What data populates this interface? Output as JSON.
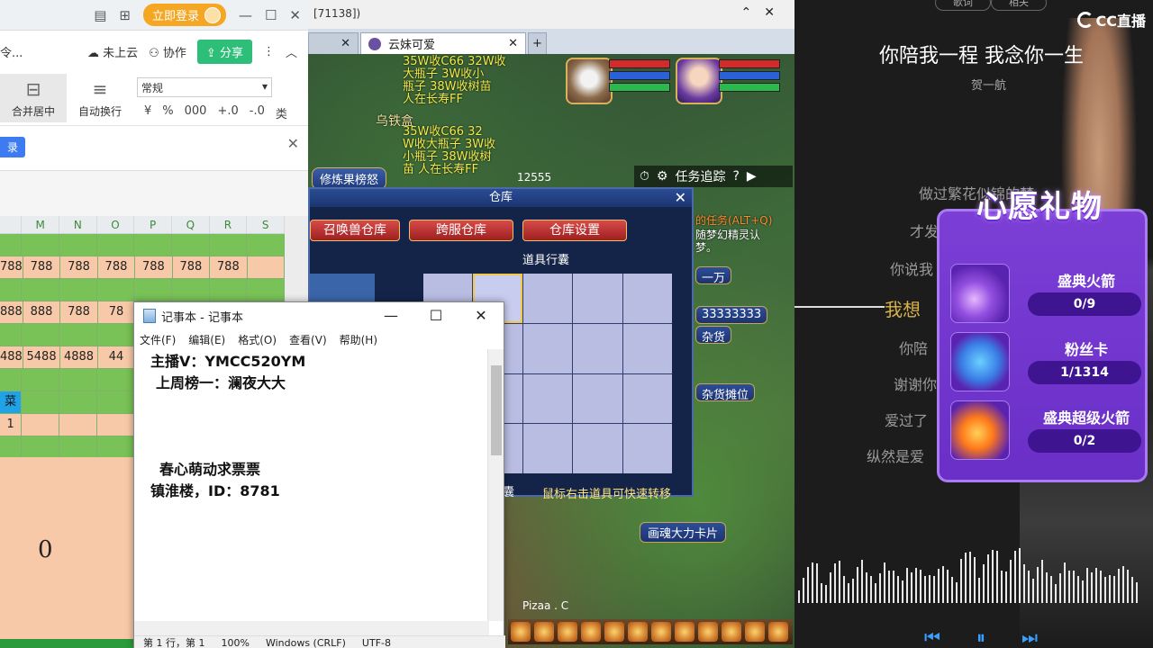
{
  "spreadsheet": {
    "login_label": "立即登录",
    "cloud_label": "未上云",
    "collab_label": "协作",
    "share_label": "分享",
    "menu_cut": "令...",
    "merge_label": "合并居中",
    "wrap_label": "自动换行",
    "format_value": "常规",
    "format_symbols": [
      "¥",
      "%",
      "000",
      "+.0",
      "-.0",
      "类"
    ],
    "banner_tag": "录",
    "columns": [
      "M",
      "N",
      "O",
      "P",
      "Q",
      "R",
      "S"
    ],
    "rows": [
      {
        "style": "green",
        "cells": [
          "",
          "",
          "",
          "",
          "",
          "",
          "",
          ""
        ]
      },
      {
        "style": "peach",
        "cells": [
          "788",
          "788",
          "788",
          "788",
          "788",
          "788",
          "788",
          ""
        ]
      },
      {
        "style": "green",
        "cells": [
          "",
          "",
          "",
          "",
          "",
          "",
          "",
          ""
        ]
      },
      {
        "style": "peach",
        "cells": [
          "888",
          "888",
          "788",
          "78",
          "",
          "",
          "",
          ""
        ]
      },
      {
        "style": "green",
        "cells": [
          "",
          "",
          "",
          "",
          "",
          "",
          "",
          ""
        ]
      },
      {
        "style": "peach",
        "cells": [
          "488",
          "5488",
          "4888",
          "44",
          "",
          "",
          "",
          ""
        ]
      },
      {
        "style": "green",
        "cells": [
          "",
          "",
          "",
          "",
          "",
          "",
          "",
          ""
        ]
      },
      {
        "style": "blue",
        "cells": [
          "菜",
          "",
          "",
          "",
          "",
          "",
          "",
          ""
        ]
      },
      {
        "style": "peach",
        "cells": [
          "1",
          "",
          "",
          "",
          "",
          "",
          "",
          ""
        ]
      },
      {
        "style": "green",
        "cells": [
          "",
          "",
          "",
          "",
          "",
          "",
          "",
          ""
        ]
      }
    ],
    "big_zero": "0"
  },
  "game": {
    "window_title": "[71138])",
    "tabs": [
      {
        "label": ""
      },
      {
        "label": "云妹可爱"
      }
    ],
    "chat_lines": [
      "35W收C66 32W收",
      "大瓶子 3W收小",
      "瓶子 38W收树苗",
      "人在长寿FF"
    ],
    "chat_lines2": [
      "35W收C66 32",
      "W收大瓶子 3W收",
      "小瓶子 38W收树",
      "苗 人在长寿FF"
    ],
    "npc_name": "乌铁盒",
    "refine_btn": "修炼果榜怒",
    "score": "12555",
    "quest_label": "任务追踪",
    "quest_hotkey": "?",
    "side_text_1": "的任务(ALT+Q)",
    "side_text_2": "随梦幻精灵认",
    "side_text_3": "梦。",
    "side_plates": [
      "一万",
      "33333333",
      "杂货",
      "杂货摊位",
      "画魂大力卡片"
    ],
    "warehouse": {
      "title": "仓库",
      "tabs": [
        "召唤兽仓库",
        "跨服仓库",
        "仓库设置"
      ],
      "section": "道具行囊",
      "hint": "鼠标右击道具可快速转移",
      "bag_btn": "囊"
    },
    "pizaa": "Pizaa . C"
  },
  "notepad": {
    "title": "记事本 - 记事本",
    "menu": [
      "文件(F)",
      "编辑(E)",
      "格式(O)",
      "查看(V)",
      "帮助(H)"
    ],
    "lines": [
      "主播V：YMCC520YM",
      "上周榜一：澜夜大大",
      "春心萌动求票票",
      "镇淮楼，ID：8781"
    ],
    "status": [
      "第 1 行，第 1",
      "100%",
      "Windows (CRLF)",
      "UTF-8"
    ]
  },
  "stream": {
    "tabs": [
      "歌词",
      "相关"
    ],
    "brand": "CC直播",
    "song_title": "你陪我一程 我念你一生",
    "singer": "贺一航",
    "lyrics": [
      {
        "text": "做过繁花似锦的梦",
        "hl": false
      },
      {
        "text": "才发",
        "hl": false
      },
      {
        "text": "你说我",
        "hl": false
      },
      {
        "text": "我想",
        "hl": true
      },
      {
        "text": "你陪",
        "hl": false
      },
      {
        "text": "谢谢你",
        "hl": false
      },
      {
        "text": "爱过了",
        "hl": false
      },
      {
        "text": "纵然是爱",
        "hl": false
      }
    ],
    "wish_title": "心愿礼物",
    "gifts": [
      {
        "name": "盛典火箭",
        "progress": "0/9",
        "icon": "rocket-icon"
      },
      {
        "name": "粉丝卡",
        "progress": "1/1314",
        "icon": "fan-card-icon"
      },
      {
        "name": "盛典超级火箭",
        "progress": "0/2",
        "icon": "super-rocket-icon"
      }
    ],
    "player_controls": [
      "⏮",
      "⏸",
      "⏭"
    ]
  }
}
